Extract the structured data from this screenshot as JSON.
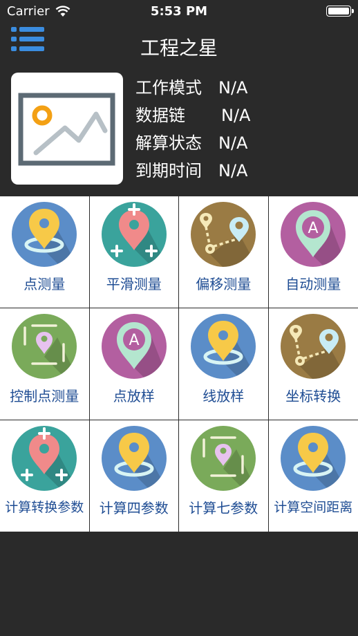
{
  "status_bar": {
    "carrier": "Carrier",
    "time": "5:53 PM"
  },
  "header": {
    "title": "工程之星"
  },
  "info": [
    {
      "key": "工作模式",
      "value": "N/A"
    },
    {
      "key": "数据链",
      "value": "N/A"
    },
    {
      "key": "解算状态",
      "value": "N/A"
    },
    {
      "key": "到期时间",
      "value": "N/A"
    }
  ],
  "colors": {
    "background": "#2a2a2a",
    "label": "#1e4c93",
    "blue": "#5b8dc8",
    "teal": "#3aa39c",
    "brown": "#9a7b44",
    "purple": "#b35fa0",
    "green": "#7aaa5a"
  },
  "grid": [
    {
      "label": "点测量",
      "icon": "pin-ring-icon"
    },
    {
      "label": "平滑测量",
      "icon": "pin-plus-icon"
    },
    {
      "label": "偏移测量",
      "icon": "route-offset-icon"
    },
    {
      "label": "自动测量",
      "icon": "pin-a-icon"
    },
    {
      "label": "控制点测量",
      "icon": "pin-frame-icon"
    },
    {
      "label": "点放样",
      "icon": "pin-a-icon"
    },
    {
      "label": "线放样",
      "icon": "pin-ring-icon"
    },
    {
      "label": "坐标转换",
      "icon": "route-offset-icon"
    },
    {
      "label": "计算转换参数",
      "icon": "pin-plus-icon"
    },
    {
      "label": "计算四参数",
      "icon": "pin-ring-icon"
    },
    {
      "label": "计算七参数",
      "icon": "pin-frame-icon"
    },
    {
      "label": "计算空间距离",
      "icon": "pin-ring-icon"
    }
  ]
}
